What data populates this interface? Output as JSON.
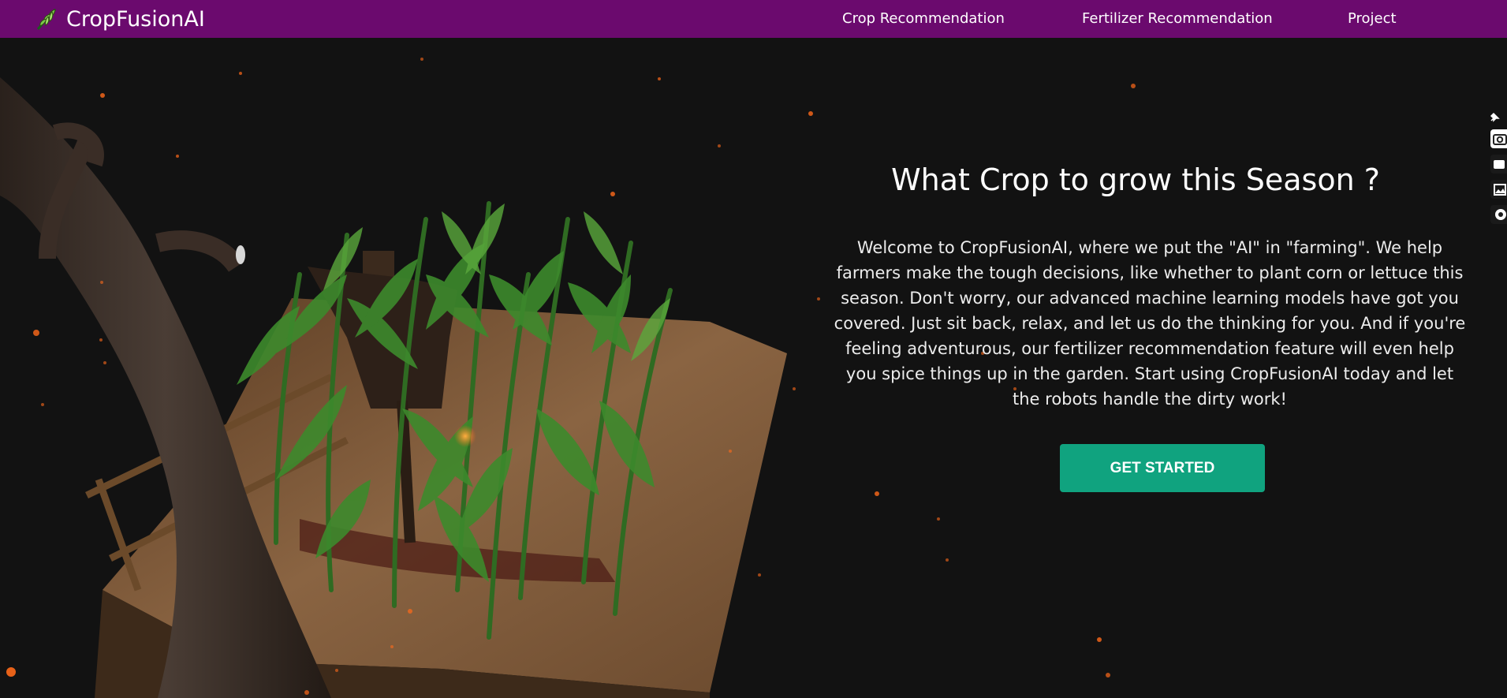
{
  "brand": {
    "name": "CropFusionAI",
    "icon": "leaf-icon"
  },
  "nav": {
    "links": [
      "Crop Recommendation",
      "Fertilizer Recommendation",
      "Project"
    ]
  },
  "hero": {
    "title": "What Crop to grow this Season ?",
    "description": "Welcome to CropFusionAI, where we put the \"AI\" in \"farming\". We help farmers make the tough decisions, like whether to plant corn or lettuce this season. Don't worry, our advanced machine learning models have got you covered. Just sit back, relax, and let us do the thinking for you. And if you're feeling adventurous, our fertilizer recommendation feature will even help you spice things up in the garden. Start using CropFusionAI today and let the robots handle the dirty work!",
    "cta": "GET STARTED",
    "art": "3d-farm-scene-with-tree-scarecrow-corn"
  },
  "side_toolbar": {
    "icons": [
      "pin-icon",
      "camera-icon",
      "video-icon",
      "gallery-icon",
      "settings-icon"
    ]
  },
  "colors": {
    "navbar": "#6b0a6e",
    "background": "#121212",
    "button": "#10a37f",
    "ember": "#ff6a1a"
  }
}
